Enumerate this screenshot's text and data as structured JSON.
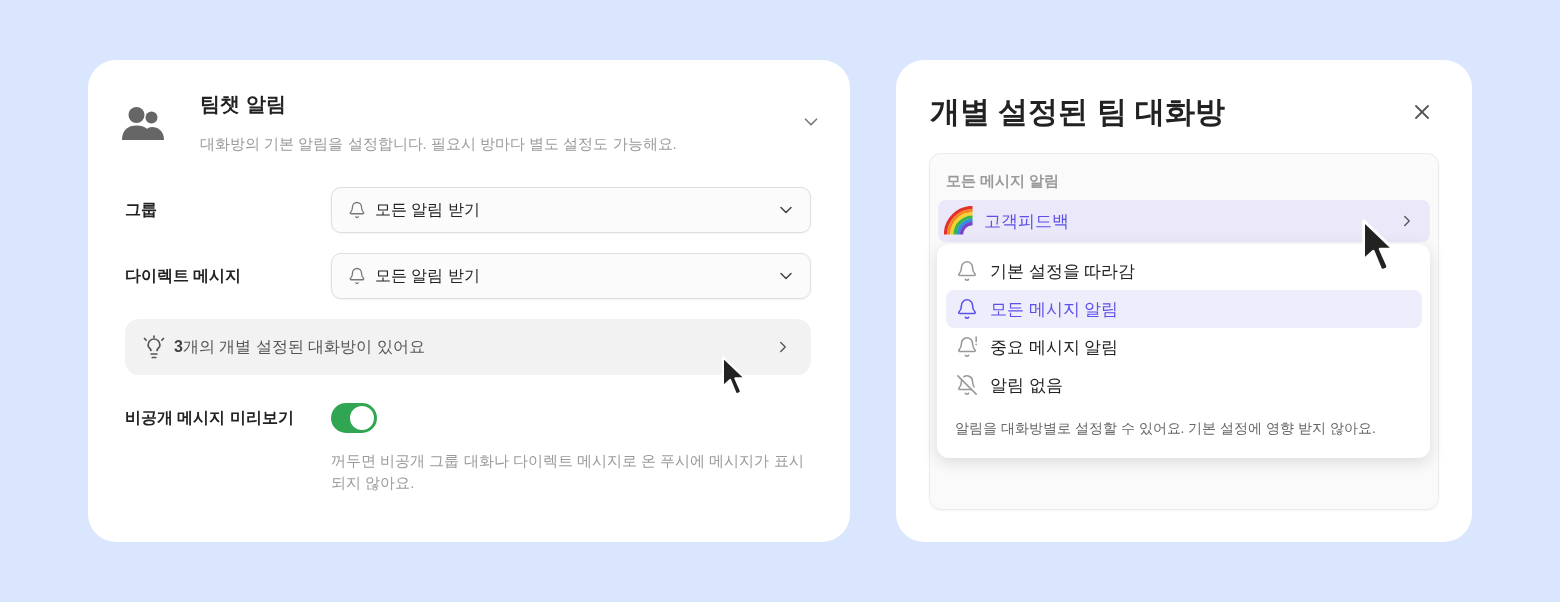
{
  "team_chat_card": {
    "title": "팀챗 알림",
    "description": "대화방의 기본 알림을 설정합니다. 필요시 방마다 별도 설정도 가능해요.",
    "settings": [
      {
        "label": "그룹",
        "value": "모든 알림 받기"
      },
      {
        "label": "다이렉트 메시지",
        "value": "모든 알림 받기"
      }
    ],
    "custom_rooms_banner": "**3**개의 개별 설정된 대화방이 있어요",
    "preview_setting": {
      "label": "비공개 메시지 미리보기",
      "on": true,
      "description": "꺼두면 비공개 그룹 대화나 다이렉트 메시지로 온 푸시에 메시지가 표시되지 않아요."
    }
  },
  "rooms_dialog": {
    "title": "개별 설정된 팀 대화방",
    "section_label": "모든 메시지 알림",
    "rooms": [
      {
        "name": "고객피드백",
        "selected": true
      }
    ],
    "notification_menu": {
      "options": [
        {
          "kind": "default",
          "label": "기본 설정을 따라감",
          "selected": false
        },
        {
          "kind": "all",
          "label": "모든 메시지 알림",
          "selected": true
        },
        {
          "kind": "important",
          "label": "중요 메시지 알림",
          "selected": false
        },
        {
          "kind": "none",
          "label": "알림 없음",
          "selected": false
        }
      ],
      "note": "알림을 대화방별로 설정할 수 있어요. 기본 설정에 영향 받지 않아요."
    }
  }
}
